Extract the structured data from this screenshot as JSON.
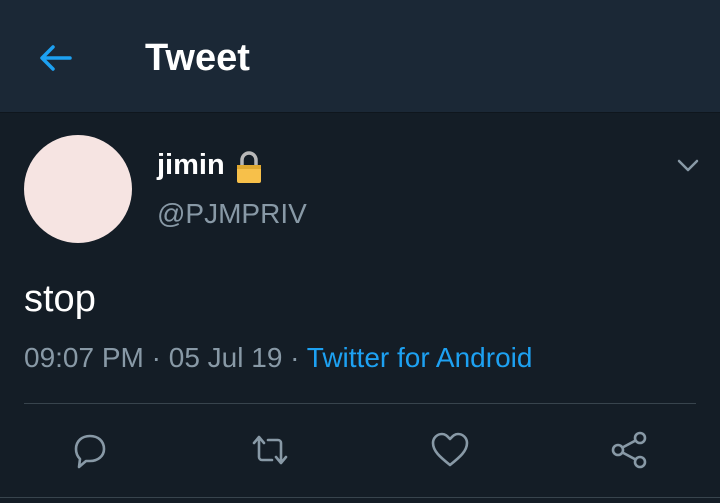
{
  "header": {
    "title": "Tweet",
    "back_icon": "arrow-left-icon"
  },
  "tweet": {
    "display_name": "jimin",
    "protected_icon": "lock-icon",
    "handle": "@PJMPRIV",
    "text": "stop",
    "time": "09:07 PM",
    "separator": "·",
    "date": "05 Jul 19",
    "source": "Twitter for Android"
  },
  "actions": [
    {
      "icon": "reply-icon"
    },
    {
      "icon": "retweet-icon"
    },
    {
      "icon": "like-icon"
    },
    {
      "icon": "share-icon"
    }
  ],
  "colors": {
    "background": "#141d26",
    "header_background": "#1b2836",
    "accent": "#1da1f2",
    "secondary_text": "#8899a6",
    "avatar": "#f6e4e2"
  }
}
